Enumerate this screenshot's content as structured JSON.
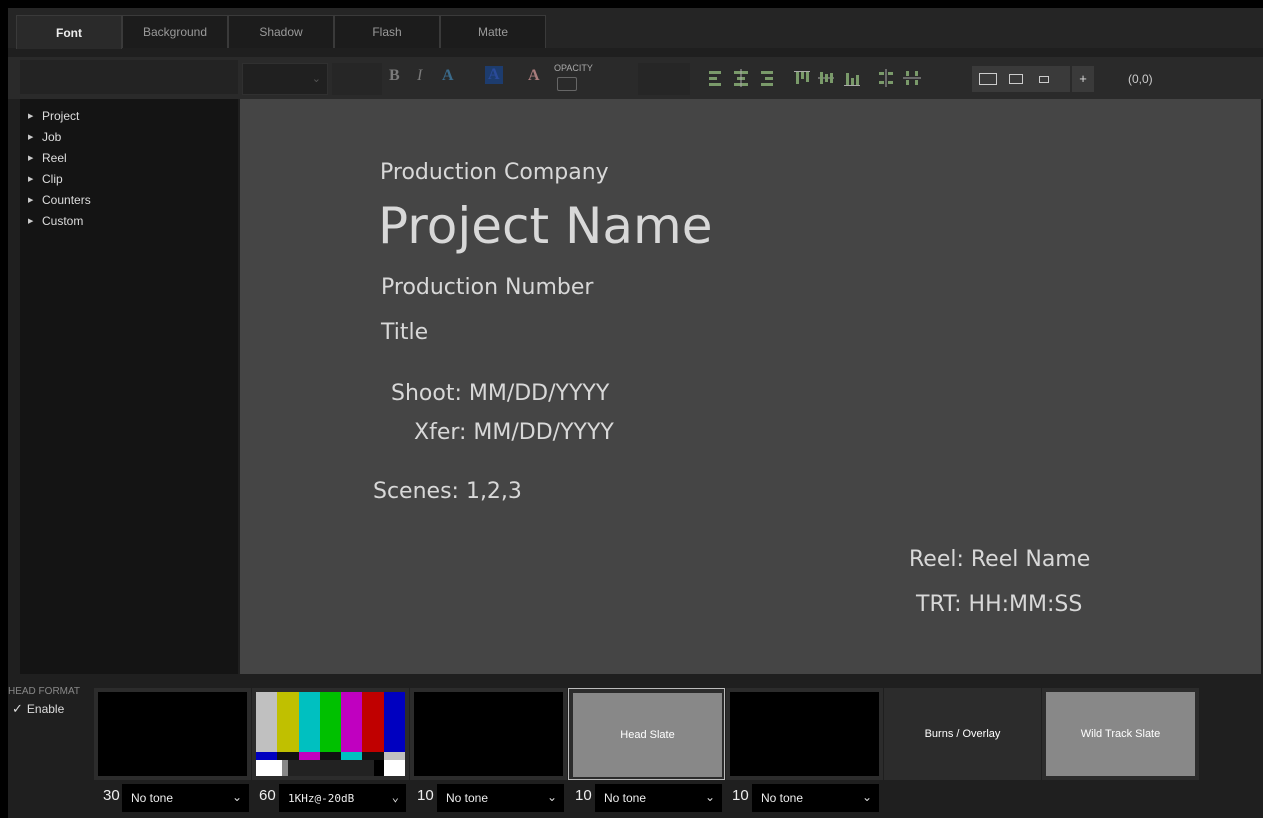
{
  "tabs": [
    {
      "label": "Font",
      "active": true
    },
    {
      "label": "Background",
      "active": false
    },
    {
      "label": "Shadow",
      "active": false
    },
    {
      "label": "Flash",
      "active": false
    },
    {
      "label": "Matte",
      "active": false
    }
  ],
  "toolbar": {
    "bold_label": "B",
    "italic_label": "I",
    "a_label_1": "A",
    "a_label_2": "A",
    "a_label_3": "A",
    "opacity_label": "OPACITY",
    "plus_label": "+",
    "coordinates": "(0,0)"
  },
  "tree": {
    "items": [
      "Project",
      "Job",
      "Reel",
      "Clip",
      "Counters",
      "Custom"
    ]
  },
  "canvas": {
    "production_company": "Production Company",
    "project_name": "Project Name",
    "production_number": "Production Number",
    "title": "Title",
    "shoot": "Shoot: MM/DD/YYYY",
    "xfer": "Xfer: MM/DD/YYYY",
    "scenes": "Scenes: 1,2,3",
    "reel": "Reel: Reel Name",
    "trt": "TRT: HH:MM:SS"
  },
  "bottom": {
    "head_format_label": "HEAD FORMAT",
    "enable_label": "Enable",
    "enable_checked": true,
    "slots": [
      {
        "label": ""
      },
      {
        "label": ""
      },
      {
        "label": ""
      },
      {
        "label": "Head Slate"
      },
      {
        "label": ""
      },
      {
        "label": "Burns / Overlay"
      },
      {
        "label": "Wild Track Slate"
      }
    ],
    "durations": [
      "30",
      "60",
      "10",
      "10",
      "10"
    ],
    "tones": [
      "No tone",
      "1KHz@-20dB",
      "No tone",
      "No tone",
      "No tone"
    ],
    "colors": {
      "bars": [
        "#c0c0c0",
        "#c0c000",
        "#00c0c0",
        "#00c000",
        "#c000c0",
        "#c00000",
        "#0000c0"
      ]
    }
  }
}
